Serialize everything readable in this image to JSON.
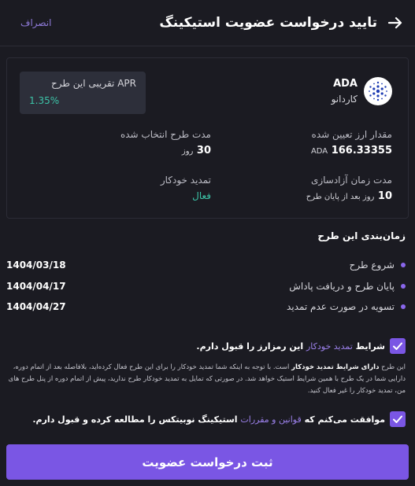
{
  "header": {
    "title": "تایید درخواست عضویت استیکینگ",
    "cancel_label": "انصراف"
  },
  "plan": {
    "coin_symbol": "ADA",
    "coin_name": "کاردانو",
    "apr_label": "APR تقریبی این طرح",
    "apr_value": "1.35%",
    "amount_label": "مقدار ارز تعیین شده",
    "amount_value": "166.33355",
    "amount_unit": "ADA",
    "duration_label": "مدت طرح انتخاب شده",
    "duration_value": "30",
    "duration_unit": "روز",
    "release_label": "مدت زمان آزادسازی",
    "release_value": "10",
    "release_suffix": "روز بعد از پایان طرح",
    "auto_renew_label": "تمدید خودکار",
    "auto_renew_value": "فعال"
  },
  "schedule": {
    "title": "زمان‌بندی این طرح",
    "items": [
      {
        "label": "شروع طرح",
        "date": "1404/03/18"
      },
      {
        "label": "پایان طرح و دریافت پاداش",
        "date": "1404/04/17"
      },
      {
        "label": "تسویه در صورت عدم تمدید",
        "date": "1404/04/27"
      }
    ]
  },
  "terms": {
    "auto_renew_prefix": "شرایط",
    "auto_renew_link": "تمدید خودکار",
    "auto_renew_suffix": "این رمزارز را قبول دارم.",
    "note_1": "این طرح",
    "note_bold": "دارای شرایط تمدید خودکار",
    "note_2": "است. با توجه به اینکه شما تمدید خودکار را برای این طرح فعال کرده‌اید، بلافاصله بعد از اتمام دوره، دارایی شما در یک طرح با همین شرایط استیک خواهد شد. در صورتی که تمایل به تمدید خودکار طرح ندارید، پیش از اتمام دوره از پنل طرح های من، تمدید خودکار را غیر فعال کنید.",
    "agree_prefix": "موافقت می‌کنم که",
    "agree_link": "قوانین و مقررات",
    "agree_suffix": "استیکینگ نوبیتکس را مطالعه کرده و قبول دارم."
  },
  "submit_label": "ثبت درخواست عضویت",
  "colors": {
    "background": "#1b1b22",
    "accent": "#7a56e4",
    "green": "#3cc4a8",
    "cardano_blue": "#1f3db3"
  }
}
